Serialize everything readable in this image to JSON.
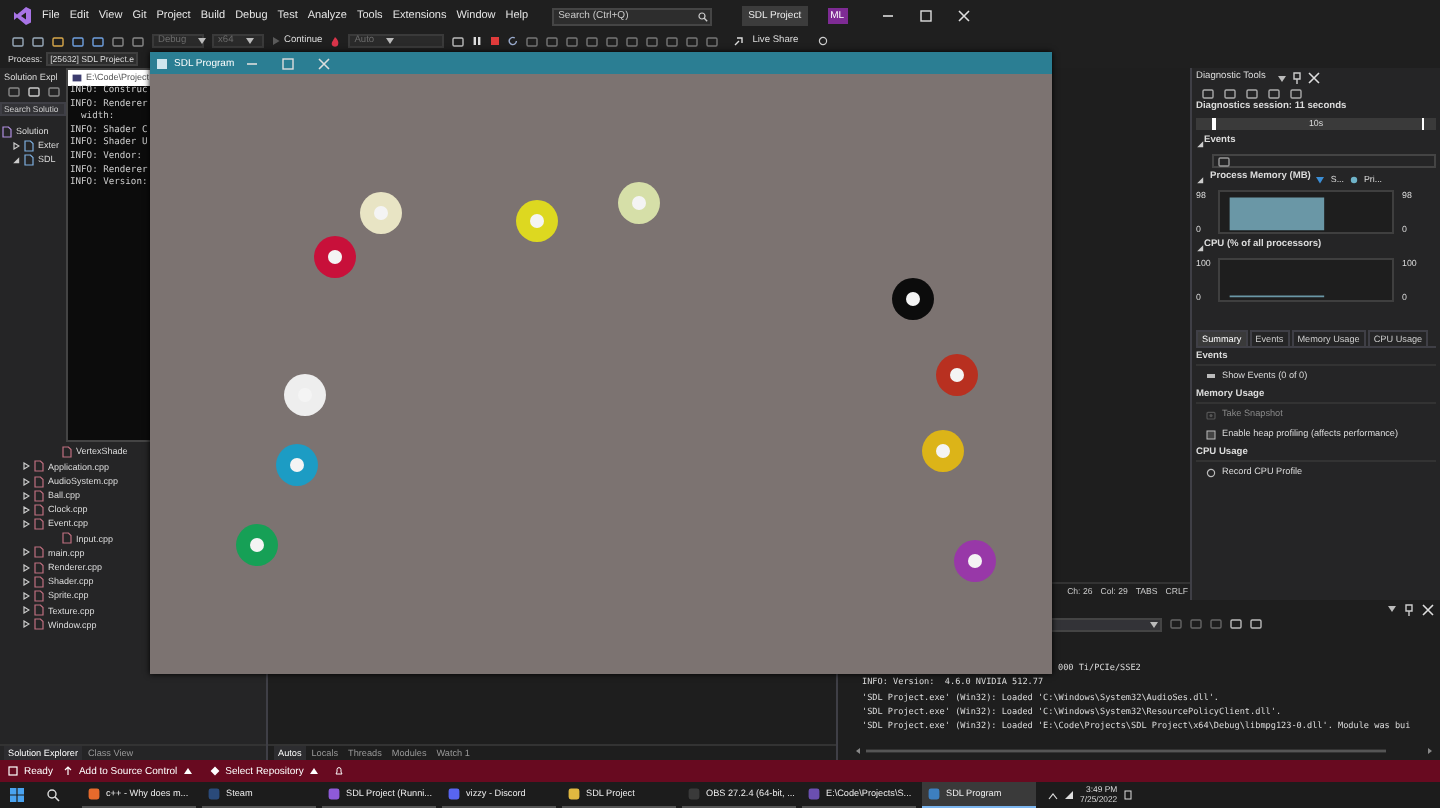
{
  "menu_bar": {
    "items": [
      "File",
      "Edit",
      "View",
      "Git",
      "Project",
      "Build",
      "Debug",
      "Test",
      "Analyze",
      "Tools",
      "Extensions",
      "Window",
      "Help"
    ],
    "search": {
      "placeholder": "Search (Ctrl+Q)"
    },
    "solution_name": "SDL Project",
    "user_initials": "ML"
  },
  "toolbar": {
    "items": [
      {
        "kind": "dropdown",
        "label": "Debug",
        "disabled": true
      },
      {
        "kind": "dropdown",
        "label": "x64",
        "disabled": true
      },
      {
        "kind": "play",
        "label": "Continue",
        "disabled": true
      },
      {
        "kind": "dropdown",
        "label": "Auto",
        "disabled": true
      }
    ],
    "live_share": "Live Share"
  },
  "process_bar": {
    "label": "Process:",
    "value": "[25632] SDL Project.e"
  },
  "solution_explorer": {
    "title": "Solution Expl",
    "search": {
      "placeholder": "Search Solutio"
    },
    "tree": [
      {
        "label": "Solution",
        "children": [
          {
            "label": "Exter",
            "expanded": false
          },
          {
            "label": "SDL",
            "expanded": true,
            "children": [
              {
                "label": "VertexShade"
              },
              {
                "label": "Application.cpp",
                "expanded": false
              },
              {
                "label": "AudioSystem.cpp",
                "expanded": false
              },
              {
                "label": "Ball.cpp",
                "expanded": false
              },
              {
                "label": "Clock.cpp",
                "expanded": false
              },
              {
                "label": "Event.cpp",
                "expanded": false
              },
              {
                "label": "Input.cpp"
              },
              {
                "label": "main.cpp",
                "expanded": false
              },
              {
                "label": "Renderer.cpp",
                "expanded": false
              },
              {
                "label": "Shader.cpp",
                "expanded": false
              },
              {
                "label": "Sprite.cpp",
                "expanded": false
              },
              {
                "label": "Texture.cpp",
                "expanded": false
              },
              {
                "label": "Window.cpp",
                "expanded": false
              }
            ]
          }
        ]
      }
    ],
    "tabs": [
      {
        "label": "Solution Explorer",
        "selected": true
      },
      {
        "label": "Class View",
        "selected": false
      }
    ]
  },
  "console_window": {
    "title": "E:\\Code\\Project",
    "lines": [
      "INFO: Construc",
      "INFO: Renderer",
      "  width:",
      "INFO: Shader C",
      "INFO: Shader U",
      "INFO: Vendor:",
      "INFO: Renderer",
      "INFO: Version:"
    ]
  },
  "editor_status": [
    "Ch: 26",
    "Col: 29",
    "TABS",
    "CRLF"
  ],
  "diagnostic_tools": {
    "title": "Diagnostic Tools",
    "session": "Diagnostics session: 11 seconds",
    "timeline_label": "10s",
    "events_label": "Events",
    "memory": {
      "title": "Process Memory (MB)",
      "legend": [
        {
          "label": "S...",
          "kind": "triangle"
        },
        {
          "label": "Pri...",
          "kind": "dot"
        }
      ],
      "left_labels": [
        "98",
        "0"
      ],
      "right_labels": [
        "98",
        "0"
      ]
    },
    "cpu": {
      "title": "CPU (% of all processors)",
      "left_labels": [
        "100",
        "0"
      ],
      "right_labels": [
        "100",
        "0"
      ]
    },
    "tabs": [
      {
        "label": "Summary",
        "selected": true
      },
      {
        "label": "Events",
        "selected": false
      },
      {
        "label": "Memory Usage",
        "selected": false
      },
      {
        "label": "CPU Usage",
        "selected": false
      }
    ],
    "sections": [
      {
        "title": "Events",
        "actions": [
          {
            "kind": "events",
            "label": "Show Events (0 of 0)",
            "disabled": false
          }
        ]
      },
      {
        "title": "Memory Usage",
        "actions": [
          {
            "kind": "snapshot",
            "label": "Take Snapshot",
            "disabled": true
          },
          {
            "kind": "checkbox",
            "label": "Enable heap profiling (affects performance)",
            "disabled": false,
            "checked": false
          }
        ]
      },
      {
        "title": "CPU Usage",
        "actions": [
          {
            "kind": "record",
            "label": "Record CPU Profile",
            "disabled": false
          }
        ]
      }
    ]
  },
  "autos": {
    "tabs": [
      {
        "label": "Autos",
        "selected": true
      },
      {
        "label": "Locals",
        "selected": false
      },
      {
        "label": "Threads",
        "selected": false
      },
      {
        "label": "Modules",
        "selected": false
      },
      {
        "label": "Watch 1",
        "selected": false
      }
    ]
  },
  "output": {
    "lines": [
      "000 Ti/PCIe/SSE2",
      "INFO: Version:  4.6.0 NVIDIA 512.77",
      "'SDL Project.exe' (Win32): Loaded 'C:\\Windows\\System32\\AudioSes.dll'.",
      "'SDL Project.exe' (Win32): Loaded 'C:\\Windows\\System32\\ResourcePolicyClient.dll'.",
      "'SDL Project.exe' (Win32): Loaded 'E:\\Code\\Projects\\SDL Project\\x64\\Debug\\libmpg123-0.dll'. Module was bui"
    ]
  },
  "sdl_window": {
    "title": "SDL Program",
    "balls": [
      {
        "color": "#e8e4c4"
      },
      {
        "color": "#ddd820"
      },
      {
        "color": "#d6dfa8"
      },
      {
        "color": "#c8103a"
      },
      {
        "color": "#0c0c0c"
      },
      {
        "color": "#b83020"
      },
      {
        "color": "#eeeeee"
      },
      {
        "color": "#1c9cc4"
      },
      {
        "color": "#dcb418"
      },
      {
        "color": "#16a056"
      },
      {
        "color": "#9838a8"
      }
    ]
  },
  "status_bar": {
    "text": "Ready",
    "source_control": "Add to Source Control",
    "repository": "Select Repository"
  },
  "taskbar": {
    "items": [
      {
        "label": "c++ - Why does m...",
        "selected": false
      },
      {
        "label": "Steam",
        "selected": false
      },
      {
        "label": "SDL Project (Runni...",
        "selected": false
      },
      {
        "label": "vizzy - Discord",
        "selected": false
      },
      {
        "label": "SDL Project",
        "selected": false
      },
      {
        "label": "OBS 27.2.4 (64-bit, ...",
        "selected": false
      },
      {
        "label": "E:\\Code\\Projects\\S...",
        "selected": false
      },
      {
        "label": "SDL Program",
        "selected": true
      }
    ],
    "time": "3:49 PM",
    "date": "7/25/2022"
  }
}
